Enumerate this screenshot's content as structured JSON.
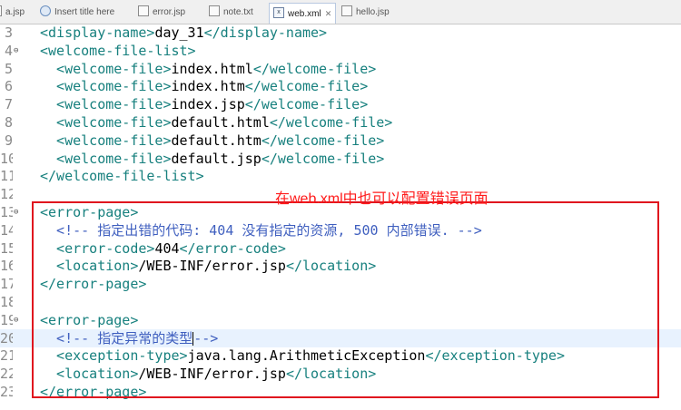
{
  "tabs": [
    {
      "label": "a.jsp",
      "icon": "jsp-file-icon",
      "active": false
    },
    {
      "label": "Insert title here",
      "icon": "web-page-icon",
      "active": false
    },
    {
      "label": "error.jsp",
      "icon": "jsp-file-icon",
      "active": false
    },
    {
      "label": "note.txt",
      "icon": "text-file-icon",
      "active": false
    },
    {
      "label": "web.xml",
      "icon": "xml-file-icon",
      "active": true,
      "close": "✕"
    },
    {
      "label": "hello.jsp",
      "icon": "jsp-file-icon",
      "active": false
    }
  ],
  "annotation": {
    "text": "在web.xml中也可以配置错误页面",
    "color": "#ff1a1a"
  },
  "colors": {
    "tag": "#17807e",
    "text": "#000000",
    "comment": "#3f5fbf",
    "box": "#e0141e",
    "current_line": "#e8f2fe"
  },
  "lines": [
    {
      "n": "3",
      "marker": "",
      "segs": [
        [
          "tg",
          "  <display-name>"
        ],
        [
          "tx",
          "day_31"
        ],
        [
          "tg",
          "</display-name>"
        ]
      ]
    },
    {
      "n": "4",
      "marker": "⊖",
      "segs": [
        [
          "tg",
          "  <welcome-file-list>"
        ]
      ]
    },
    {
      "n": "5",
      "marker": "",
      "segs": [
        [
          "tg",
          "    <welcome-file>"
        ],
        [
          "tx",
          "index.html"
        ],
        [
          "tg",
          "</welcome-file>"
        ]
      ]
    },
    {
      "n": "6",
      "marker": "",
      "segs": [
        [
          "tg",
          "    <welcome-file>"
        ],
        [
          "tx",
          "index.htm"
        ],
        [
          "tg",
          "</welcome-file>"
        ]
      ]
    },
    {
      "n": "7",
      "marker": "",
      "segs": [
        [
          "tg",
          "    <welcome-file>"
        ],
        [
          "tx",
          "index.jsp"
        ],
        [
          "tg",
          "</welcome-file>"
        ]
      ]
    },
    {
      "n": "8",
      "marker": "",
      "segs": [
        [
          "tg",
          "    <welcome-file>"
        ],
        [
          "tx",
          "default.html"
        ],
        [
          "tg",
          "</welcome-file>"
        ]
      ]
    },
    {
      "n": "9",
      "marker": "",
      "segs": [
        [
          "tg",
          "    <welcome-file>"
        ],
        [
          "tx",
          "default.htm"
        ],
        [
          "tg",
          "</welcome-file>"
        ]
      ]
    },
    {
      "n": "10",
      "marker": "",
      "segs": [
        [
          "tg",
          "    <welcome-file>"
        ],
        [
          "tx",
          "default.jsp"
        ],
        [
          "tg",
          "</welcome-file>"
        ]
      ]
    },
    {
      "n": "11",
      "marker": "",
      "segs": [
        [
          "tg",
          "  </welcome-file-list>"
        ]
      ]
    },
    {
      "n": "12",
      "marker": "",
      "segs": []
    },
    {
      "n": "13",
      "marker": "⊖",
      "segs": [
        [
          "tg",
          "  <error-page>"
        ]
      ]
    },
    {
      "n": "14",
      "marker": "",
      "segs": [
        [
          "cm",
          "    <!-- 指定出错的代码: 404 没有指定的资源, 500 内部错误. -->"
        ]
      ]
    },
    {
      "n": "15",
      "marker": "",
      "segs": [
        [
          "tg",
          "    <error-code>"
        ],
        [
          "tx",
          "404"
        ],
        [
          "tg",
          "</error-code>"
        ]
      ]
    },
    {
      "n": "16",
      "marker": "",
      "segs": [
        [
          "tg",
          "    <location>"
        ],
        [
          "tx",
          "/WEB-INF/error.jsp"
        ],
        [
          "tg",
          "</location>"
        ]
      ]
    },
    {
      "n": "17",
      "marker": "",
      "segs": [
        [
          "tg",
          "  </error-page>"
        ]
      ]
    },
    {
      "n": "18",
      "marker": "",
      "segs": []
    },
    {
      "n": "19",
      "marker": "⊖",
      "segs": [
        [
          "tg",
          "  <error-page>"
        ]
      ]
    },
    {
      "n": "20",
      "marker": "",
      "hl": true,
      "segs": [
        [
          "cm",
          "    <!-- 指定异常的类型"
        ],
        [
          "caret",
          ""
        ],
        [
          "cm",
          "-->"
        ]
      ]
    },
    {
      "n": "21",
      "marker": "",
      "segs": [
        [
          "tg",
          "    <exception-type>"
        ],
        [
          "tx",
          "java.lang.ArithmeticException"
        ],
        [
          "tg",
          "</exception-type>"
        ]
      ]
    },
    {
      "n": "22",
      "marker": "",
      "segs": [
        [
          "tg",
          "    <location>"
        ],
        [
          "tx",
          "/WEB-INF/error.jsp"
        ],
        [
          "tg",
          "</location>"
        ]
      ]
    },
    {
      "n": "23",
      "marker": "",
      "segs": [
        [
          "tg",
          "  </error-page>"
        ]
      ]
    }
  ]
}
